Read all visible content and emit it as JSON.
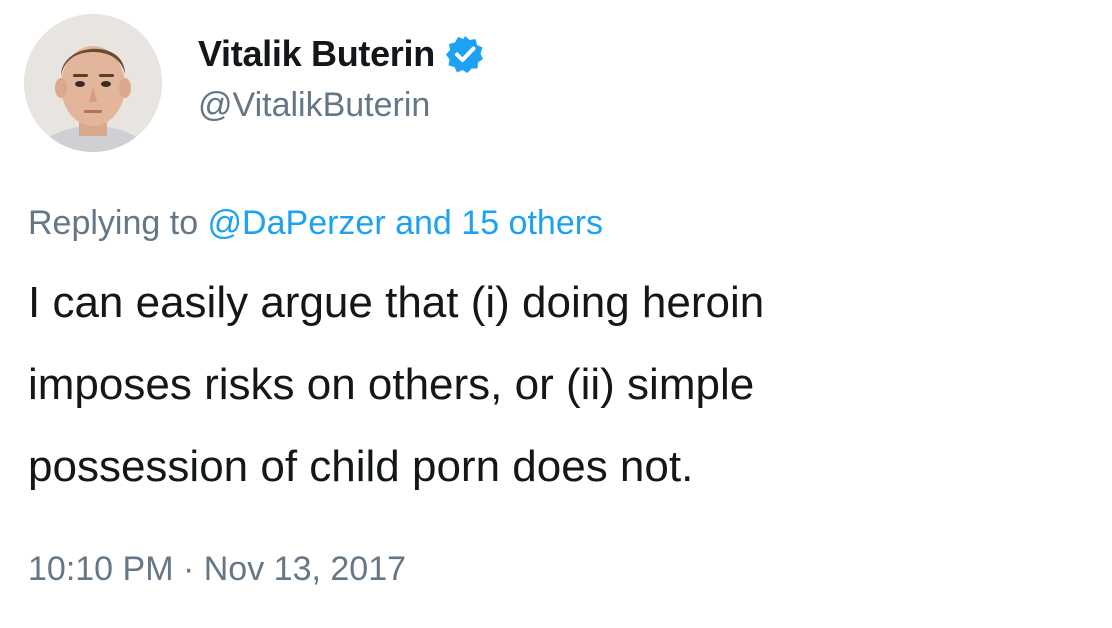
{
  "author": {
    "display_name": "Vitalik Buterin",
    "handle": "@VitalikButerin",
    "verified_color": "#1da1f2",
    "avatar_icon": "profile-photo"
  },
  "reply": {
    "prefix": "Replying to ",
    "mentions": "@DaPerzer and 15 others"
  },
  "tweet": {
    "text": "I can easily argue that (i) doing heroin\nimposes risks on others, or (ii) simple\npossession of child porn does not."
  },
  "meta": {
    "time": "10:10 PM",
    "separator": " · ",
    "date": "Nov 13, 2017"
  },
  "colors": {
    "text_primary": "#14171a",
    "text_secondary": "#657786",
    "link": "#1da1f2"
  }
}
